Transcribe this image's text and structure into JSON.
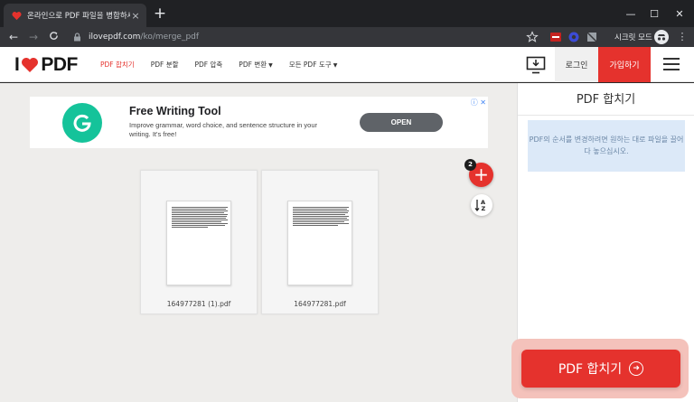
{
  "browser": {
    "tab_title": "온라인으로 PDF 파일을 병합하세",
    "tab_close": "×",
    "new_tab": "+",
    "url_host": "ilovepdf.com",
    "url_path": "/ko/merge_pdf",
    "incognito_label": "시크릿 모드",
    "window_minimize": "—",
    "window_maximize": "☐",
    "window_close": "✕",
    "nav_back": "←",
    "nav_forward": "→",
    "nav_reload": "C"
  },
  "header": {
    "logo_i": "I",
    "logo_pdf": "PDF",
    "menu": [
      {
        "label": "PDF 합치기"
      },
      {
        "label": "PDF 분할"
      },
      {
        "label": "PDF 압축"
      },
      {
        "label": "PDF 변환"
      },
      {
        "label": "모든 PDF 도구"
      }
    ],
    "login_label": "로그인",
    "signup_label": "가입하기",
    "accent_color": "#e5322d"
  },
  "ad": {
    "title": "Free Writing Tool",
    "description": "Improve grammar, word choice, and sentence structure in your writing. It's free!",
    "cta": "OPEN"
  },
  "workspace": {
    "files": [
      {
        "name": "164977281 (1).pdf"
      },
      {
        "name": "164977281.pdf"
      }
    ],
    "file_count": "2",
    "add_symbol": "+"
  },
  "sidebar": {
    "title": "PDF 합치기",
    "info_text": "PDF의 순서를 변경하려면 원하는 대로 파일을 끌어다 놓으십시오.",
    "merge_button_label": "PDF 합치기"
  }
}
